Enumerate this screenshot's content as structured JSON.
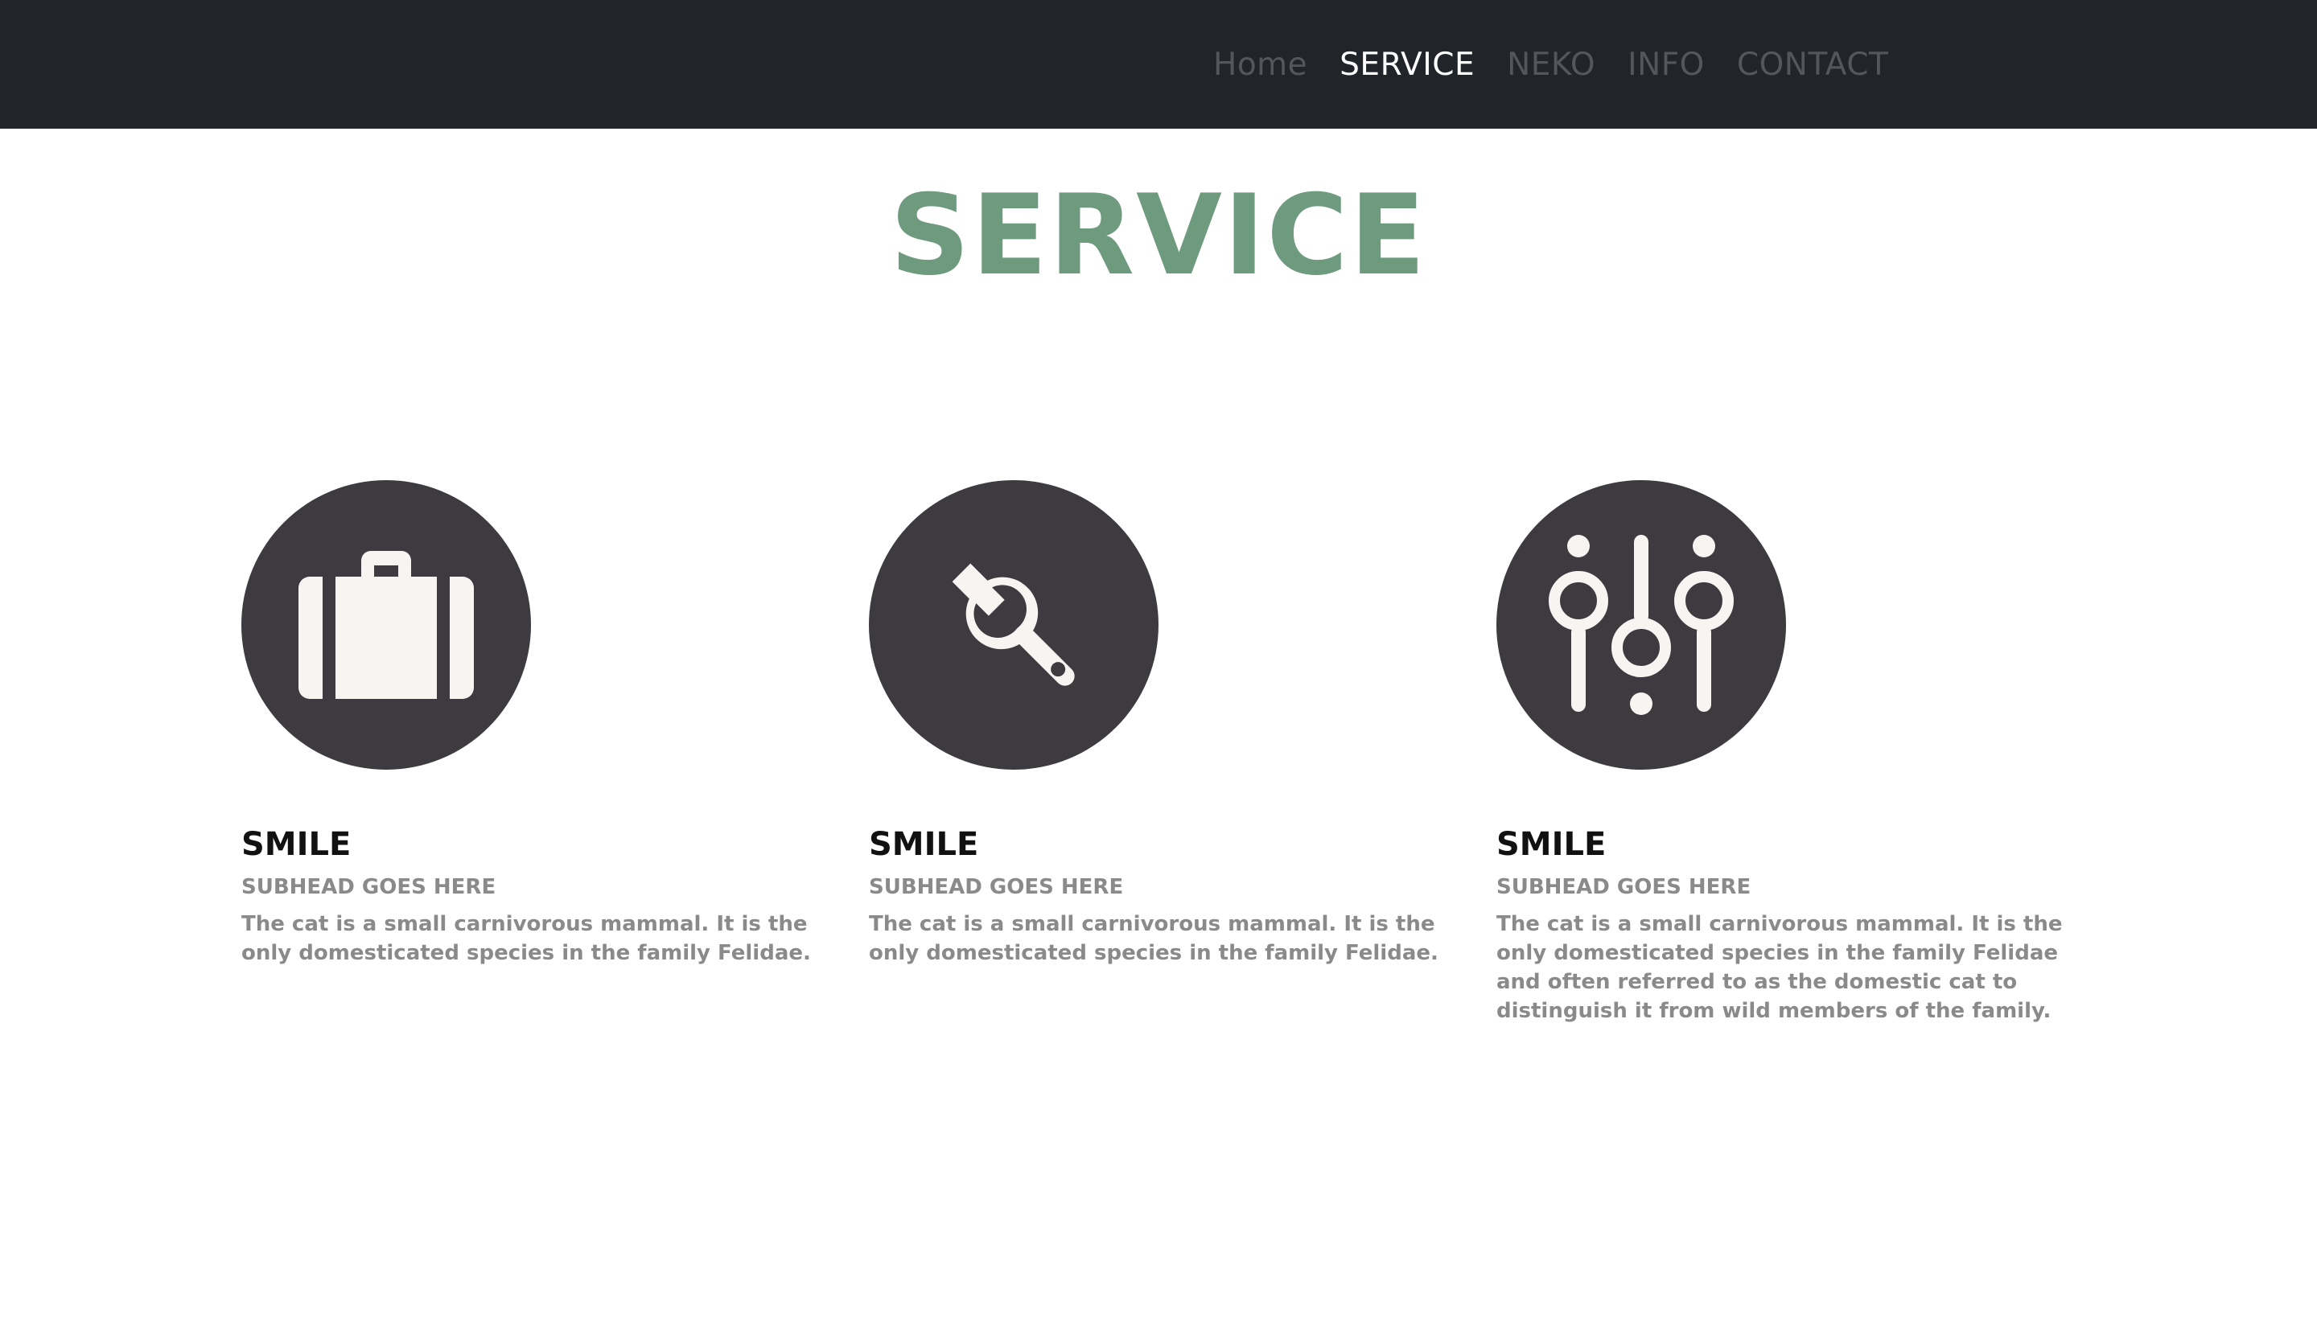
{
  "nav": {
    "items": [
      {
        "label": "Home",
        "active": false
      },
      {
        "label": "SERVICE",
        "active": true
      },
      {
        "label": "NEKO",
        "active": false
      },
      {
        "label": "INFO",
        "active": false
      },
      {
        "label": "CONTACT",
        "active": false
      }
    ]
  },
  "section": {
    "title": "SERVICE"
  },
  "cards": [
    {
      "icon": "briefcase-icon",
      "title": "SMILE",
      "subhead": "SUBHEAD GOES HERE",
      "text": "The cat is a small carnivorous mammal. It is the only domesticated species in the family Felidae."
    },
    {
      "icon": "wrench-icon",
      "title": "SMILE",
      "subhead": "SUBHEAD GOES HERE",
      "text": "The cat is a small carnivorous mammal. It is the only domesticated species in the family Felidae."
    },
    {
      "icon": "sliders-icon",
      "title": "SMILE",
      "subhead": "SUBHEAD GOES HERE",
      "text": "The cat is a small carnivorous mammal. It is the only domesticated species in the family Felidae and often referred to as the domestic cat to distinguish it from wild members of the family."
    }
  ],
  "colors": {
    "navbar_bg": "#212428",
    "nav_inactive": "#53575b",
    "nav_active": "#ffffff",
    "accent": "#6e9a7e",
    "icon_circle": "#3d3b3f",
    "icon_fill": "#f7f5f2",
    "body_text": "#8a8a8a"
  }
}
